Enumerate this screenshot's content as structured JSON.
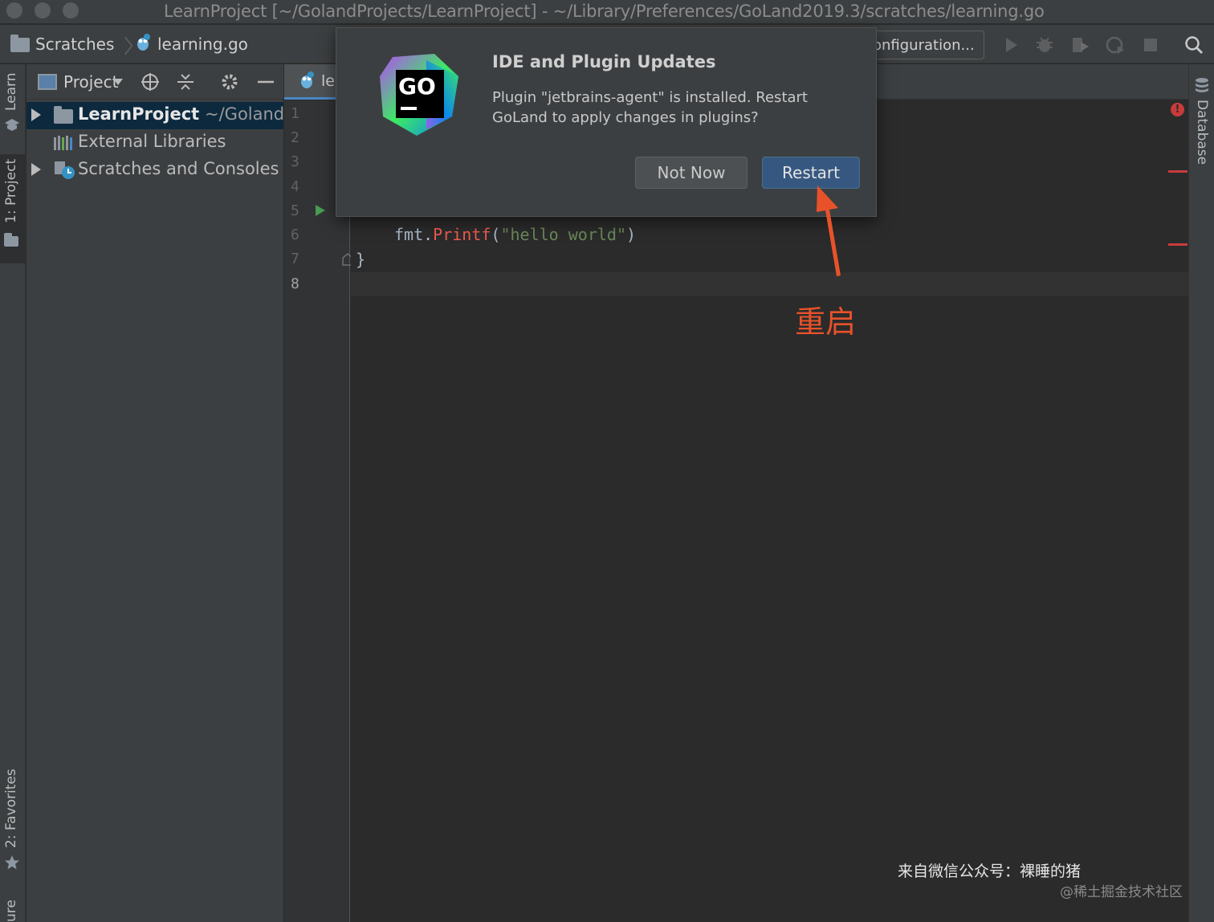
{
  "window": {
    "title": "LearnProject [~/GolandProjects/LearnProject] - ~/Library/Preferences/GoLand2019.3/scratches/learning.go"
  },
  "navbar": {
    "breadcrumb_1": "Scratches",
    "breadcrumb_2": "learning.go",
    "config_label": "onfiguration..."
  },
  "left_stripe": {
    "learn": "Learn",
    "project": "1: Project",
    "favorites": "2: Favorites",
    "structure": "ure"
  },
  "right_stripe": {
    "database": "Database"
  },
  "project_panel": {
    "view_label": "Project",
    "tree": [
      {
        "label": "LearnProject",
        "path": "~/GolandP"
      },
      {
        "label": "External Libraries"
      },
      {
        "label": "Scratches and Consoles"
      }
    ]
  },
  "editor": {
    "tab_label": "le",
    "line_numbers": [
      "1",
      "2",
      "3",
      "4",
      "5",
      "6",
      "7",
      "8"
    ],
    "code_line_6": {
      "receiver": "fmt",
      "dot": ".",
      "func": "Printf",
      "open": "(",
      "str": "\"hello world\"",
      "close": ")"
    },
    "code_line_7": "}"
  },
  "popup": {
    "title": "IDE and Plugin Updates",
    "message": "Plugin \"jetbrains-agent\" is installed. Restart GoLand to apply changes in plugins?",
    "logo_text": "GO",
    "not_now_label": "Not Now",
    "restart_label": "Restart"
  },
  "annotation": {
    "text": "重启",
    "color": "#e8522a"
  },
  "watermark": {
    "line1": "来自微信公众号：裸睡的猪",
    "line2": "@稀土掘金技术社区"
  },
  "colors": {
    "accent": "#4a88c7",
    "restart_button": "#365880",
    "error": "#c93b3b"
  }
}
